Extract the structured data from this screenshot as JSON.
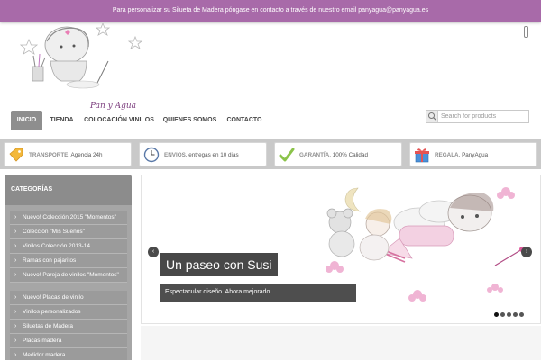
{
  "topbar": {
    "message": "Para personalizar su Silueta de Madera póngase en contacto a través de nuestro email panyagua@panyagua.es"
  },
  "logo": {
    "text": "Pan y Agua"
  },
  "nav": {
    "items": [
      {
        "label": "INICIO",
        "active": true
      },
      {
        "label": "TIENDA"
      },
      {
        "label": "COLOCACIÓN VINILOS"
      },
      {
        "label": "QUIENES SOMOS"
      },
      {
        "label": "CONTACTO"
      }
    ]
  },
  "search": {
    "placeholder": "Search for products"
  },
  "features": [
    {
      "title": "TRANSPORTE",
      "text": ", Agencia 24h",
      "icon": "price-tag-icon"
    },
    {
      "title": "ENVIOS",
      "text": ", entregas en 10 dias",
      "icon": "clock-icon"
    },
    {
      "title": "GARANTÍA",
      "text": ", 100% Calidad",
      "icon": "checkmark-icon"
    },
    {
      "title": "REGALA",
      "text": ", PanyAgua",
      "icon": "gift-icon"
    }
  ],
  "sidebar": {
    "title": "CATEGORÍAS",
    "items": [
      "Nuevo! Colección 2015 \"Momentos\"",
      "Colección \"Mis Sueños\"",
      "Vinilos Colección 2013-14",
      "Ramas con pajaritos",
      "Nuevo! Pareja de vinilos \"Momentos\"",
      "Nuevo! Placas de vinilo",
      "Vinilos personalizados",
      "Siluetas de Madera",
      "Placas madera",
      "Medidor madera"
    ]
  },
  "slider": {
    "title": "Un paseo con Susi",
    "caption": "Espectacular diseño. Ahora mejorado.",
    "prev": "‹",
    "next": "›",
    "slide_count": 5,
    "active_slide": 1
  },
  "colors": {
    "topbar": "#a86aa9",
    "accent_pink": "#e8a2c8",
    "sidebar": "#9b9b9b"
  }
}
